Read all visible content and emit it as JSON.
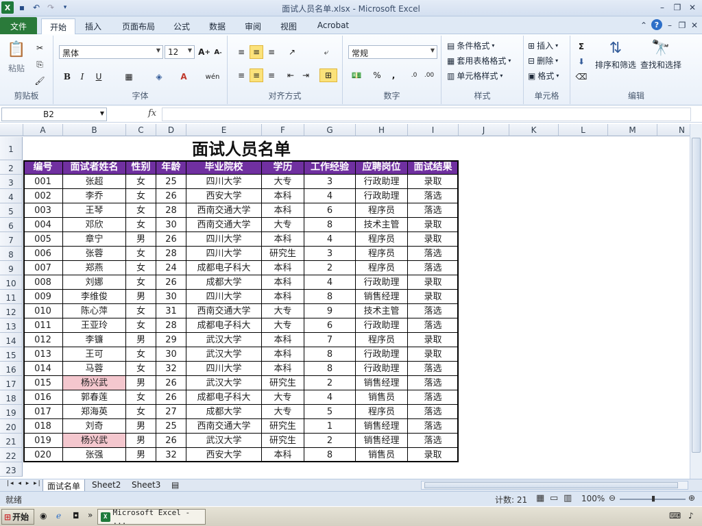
{
  "window": {
    "title": "面试人员名单.xlsx - Microsoft Excel"
  },
  "tabs": [
    "文件",
    "开始",
    "插入",
    "页面布局",
    "公式",
    "数据",
    "审阅",
    "视图",
    "Acrobat"
  ],
  "ribbon": {
    "clipboard": {
      "paste": "粘贴",
      "label": "剪贴板"
    },
    "font": {
      "name": "黑体",
      "size": "12",
      "label": "字体"
    },
    "alignment": {
      "label": "对齐方式"
    },
    "number": {
      "format": "常规",
      "label": "数字"
    },
    "styles": {
      "cond": "条件格式",
      "table": "套用表格格式",
      "cell": "单元格样式",
      "label": "样式"
    },
    "cells": {
      "insert": "插入",
      "delete": "删除",
      "format": "格式",
      "label": "单元格"
    },
    "editing": {
      "sort": "排序和筛选",
      "find": "查找和选择",
      "label": "编辑"
    }
  },
  "formula_bar": {
    "name_box": "B2",
    "fx": "fx",
    "formula": ""
  },
  "columns": [
    "A",
    "B",
    "C",
    "D",
    "E",
    "F",
    "G",
    "H",
    "I",
    "J",
    "K",
    "L",
    "M",
    "N"
  ],
  "rows": [
    "1",
    "2",
    "3",
    "4",
    "5",
    "6",
    "7",
    "8",
    "9",
    "10",
    "11",
    "12",
    "13",
    "14",
    "15",
    "16",
    "17",
    "18",
    "19",
    "20",
    "21",
    "22",
    "23"
  ],
  "sheet_title": "面试人员名单",
  "table": {
    "headers": [
      "编号",
      "面试者姓名",
      "性别",
      "年龄",
      "毕业院校",
      "学历",
      "工作经验",
      "应聘岗位",
      "面试结果"
    ],
    "rows": [
      [
        "001",
        "张超",
        "女",
        "25",
        "四川大学",
        "大专",
        "3",
        "行政助理",
        "录取"
      ],
      [
        "002",
        "李乔",
        "女",
        "26",
        "西安大学",
        "本科",
        "4",
        "行政助理",
        "落选"
      ],
      [
        "003",
        "王琴",
        "女",
        "28",
        "西南交通大学",
        "本科",
        "6",
        "程序员",
        "落选"
      ],
      [
        "004",
        "邓欣",
        "女",
        "30",
        "西南交通大学",
        "大专",
        "8",
        "技术主管",
        "录取"
      ],
      [
        "005",
        "章宁",
        "男",
        "26",
        "四川大学",
        "本科",
        "4",
        "程序员",
        "录取"
      ],
      [
        "006",
        "张蓉",
        "女",
        "28",
        "四川大学",
        "研究生",
        "3",
        "程序员",
        "落选"
      ],
      [
        "007",
        "郑燕",
        "女",
        "24",
        "成都电子科大",
        "本科",
        "2",
        "程序员",
        "落选"
      ],
      [
        "008",
        "刘娜",
        "女",
        "26",
        "成都大学",
        "本科",
        "4",
        "行政助理",
        "录取"
      ],
      [
        "009",
        "李维俊",
        "男",
        "30",
        "四川大学",
        "本科",
        "8",
        "销售经理",
        "录取"
      ],
      [
        "010",
        "陈心萍",
        "女",
        "31",
        "西南交通大学",
        "大专",
        "9",
        "技术主管",
        "落选"
      ],
      [
        "011",
        "王亚玲",
        "女",
        "28",
        "成都电子科大",
        "大专",
        "6",
        "行政助理",
        "落选"
      ],
      [
        "012",
        "李镰",
        "男",
        "29",
        "武汉大学",
        "本科",
        "7",
        "程序员",
        "录取"
      ],
      [
        "013",
        "王可",
        "女",
        "30",
        "武汉大学",
        "本科",
        "8",
        "行政助理",
        "录取"
      ],
      [
        "014",
        "马蓉",
        "女",
        "32",
        "四川大学",
        "本科",
        "8",
        "行政助理",
        "落选"
      ],
      [
        "015",
        "杨兴武",
        "男",
        "26",
        "武汉大学",
        "研究生",
        "2",
        "销售经理",
        "落选"
      ],
      [
        "016",
        "郭春莲",
        "女",
        "26",
        "成都电子科大",
        "大专",
        "4",
        "销售员",
        "落选"
      ],
      [
        "017",
        "郑海英",
        "女",
        "27",
        "成都大学",
        "大专",
        "5",
        "程序员",
        "落选"
      ],
      [
        "018",
        "刘奇",
        "男",
        "25",
        "西南交通大学",
        "研究生",
        "1",
        "销售经理",
        "落选"
      ],
      [
        "019",
        "杨兴武",
        "男",
        "26",
        "武汉大学",
        "研究生",
        "2",
        "销售经理",
        "落选"
      ],
      [
        "020",
        "张强",
        "男",
        "32",
        "西安大学",
        "本科",
        "8",
        "销售员",
        "录取"
      ]
    ],
    "highlight_color": "#f4c7ce",
    "header_color": "#7030a0"
  },
  "sheets": [
    "面试名单",
    "Sheet2",
    "Sheet3"
  ],
  "status": {
    "ready": "就绪",
    "count": "计数: 21",
    "zoom": "100%"
  },
  "taskbar": {
    "start": "开始",
    "task": "Microsoft Excel - ..."
  }
}
